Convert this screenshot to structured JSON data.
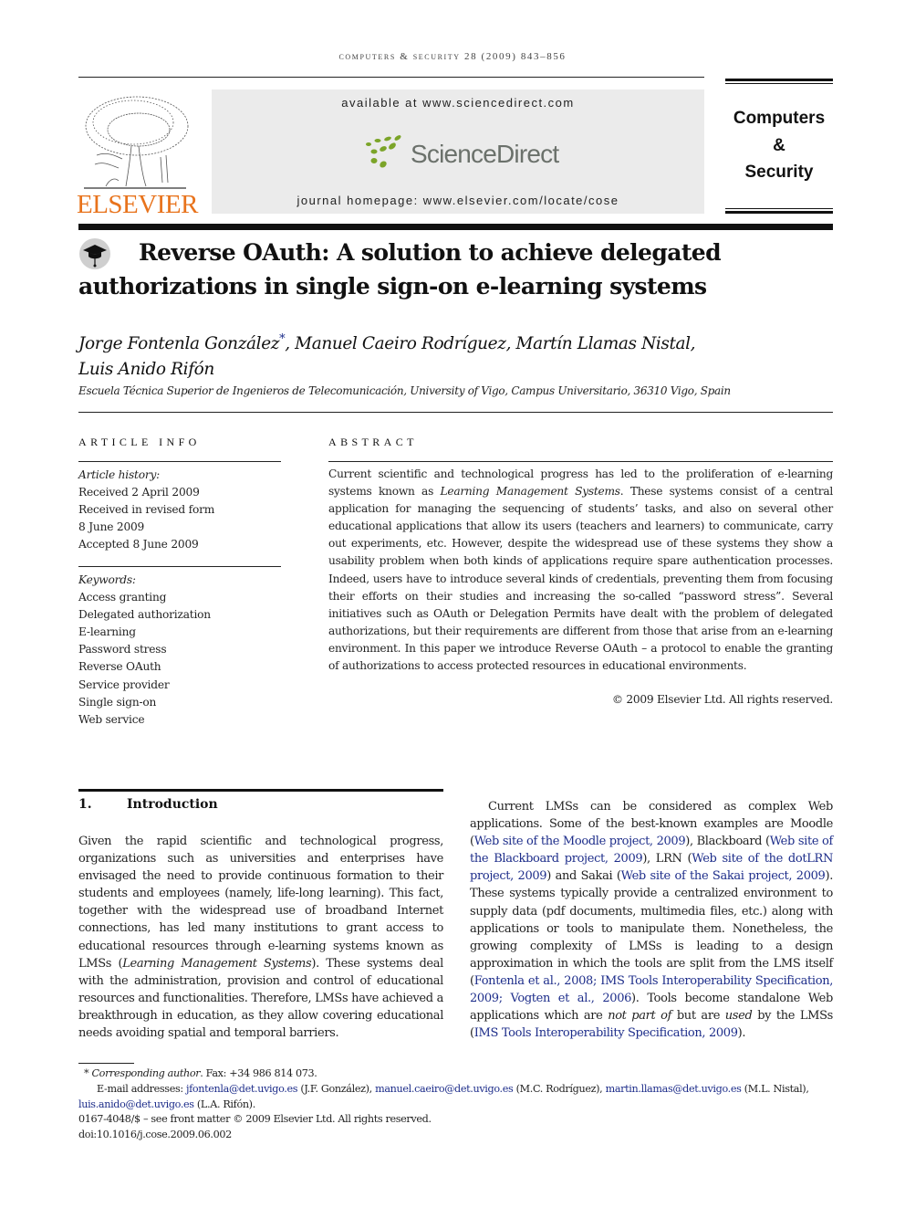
{
  "running_header": "computers & security 28 (2009) 843–856",
  "masthead": {
    "publisher_logo_text": "ELSEVIER",
    "available_text": "available at www.sciencedirect.com",
    "sciencedirect_logo_text": "ScienceDirect",
    "homepage_text": "journal homepage: www.elsevier.com/locate/cose",
    "journal_name_lines": [
      "Computers",
      "&",
      "Security"
    ],
    "colors": {
      "elsevier_orange": "#e8731c",
      "sciencedirect_green": "#7ba428",
      "masthead_bg": "#ebebeb"
    }
  },
  "article": {
    "title": "Reverse OAuth: A solution to achieve delegated authorizations in single sign-on e-learning systems",
    "title_icon": "mortarboard-icon",
    "authors": [
      {
        "name": "Jorge Fontenla González",
        "corresponding_mark": "*"
      },
      {
        "name": "Manuel Caeiro Rodríguez"
      },
      {
        "name": "Martín Llamas Nistal"
      },
      {
        "name": "Luis Anido Rifón"
      }
    ],
    "affiliation": "Escuela Técnica Superior de Ingenieros de Telecomunicación, University of Vigo, Campus Universitario, 36310 Vigo, Spain"
  },
  "article_info": {
    "heading": "ARTICLE INFO",
    "history_label": "Article history:",
    "history": [
      "Received 2 April 2009",
      "Received in revised form",
      "8 June 2009",
      "Accepted 8 June 2009"
    ],
    "keywords_label": "Keywords:",
    "keywords": [
      "Access granting",
      "Delegated authorization",
      "E-learning",
      "Password stress",
      "Reverse OAuth",
      "Service provider",
      "Single sign-on",
      "Web service"
    ]
  },
  "abstract": {
    "heading": "ABSTRACT",
    "text_before_italic": "Current scientific and technological progress has led to the proliferation of e-learning systems known as ",
    "italic": "Learning Management Systems",
    "text_after_italic": ". These systems consist of a central application for managing the sequencing of students’ tasks, and also on several other educational applications that allow its users (teachers and learners) to communicate, carry out experiments, etc. However, despite the widespread use of these systems they show a usability problem when both kinds of applications require spare authentication processes. Indeed, users have to introduce several kinds of credentials, preventing them from focusing their efforts on their studies and increasing the so-called “password stress”. Several initiatives such as OAuth or Delegation Permits have dealt with the problem of delegated authorizations, but their requirements are different from those that arise from an e-learning environment. In this paper we introduce Reverse OAuth – a protocol to enable the granting of authorizations to access protected resources in educational environments.",
    "copyright": "© 2009 Elsevier Ltd. All rights reserved."
  },
  "section1": {
    "number": "1.",
    "title": "Introduction",
    "left": {
      "p1": "Given the rapid scientific and technological progress, organizations such as universities and enterprises have envisaged the need to provide continuous formation to their students and employees (namely, life-long learning). This fact, together with the widespread use of broadband Internet connections, has led many institutions to grant access to educational resources through e-learning systems known as LMSs (",
      "italic": "Learning Management Systems",
      "p2": "). These systems deal with the administration, provision and control of educational resources and functionalities. Therefore, LMSs have achieved a breakthrough in education, as they allow covering educational needs avoiding spatial and temporal barriers."
    },
    "right": {
      "t1": "Current LMSs can be considered as complex Web applications. Some of the best-known examples are Moodle (",
      "ref_moodle": "Web site of the Moodle project, 2009",
      "t2": "), Blackboard (",
      "ref_blackboard": "Web site of the Blackboard project, 2009",
      "t3": "), LRN (",
      "ref_dotlrn": "Web site of the dotLRN project, 2009",
      "t4": ") and Sakai (",
      "ref_sakai": "Web site of the Sakai project, 2009",
      "t5": "). These systems typically provide a centralized environment to supply data (pdf documents, multimedia files, etc.) along with applications or tools to manipulate them. Nonetheless, the growing complexity of LMSs is leading to a design approximation in which the tools are split from the LMS itself (",
      "ref_fontenla": "Fontenla et al., 2008",
      "sep1": "; ",
      "ref_ims1": "IMS Tools Interoperability Specification, 2009",
      "sep2": "; ",
      "ref_vogten": "Vogten et al., 2006",
      "t6": "). Tools become standalone Web applications which are ",
      "italic1": "not part of",
      "t7": " but are ",
      "italic2": "used",
      "t8": " by the LMSs (",
      "ref_ims2": "IMS Tools Interoperability Specification, 2009",
      "t9": ")."
    }
  },
  "footnotes": {
    "corresponding_mark": "*",
    "corresponding_label": "Corresponding author",
    "corresponding_rest": ". Fax: +34 986 814 073.",
    "emails_label": "E-mail addresses: ",
    "emails": [
      {
        "address": "jfontenla@det.uvigo.es",
        "owner": " (J.F. González), "
      },
      {
        "address": "manuel.caeiro@det.uvigo.es",
        "owner": " (M.C. Rodríguez), "
      },
      {
        "address": "martin.llamas@det.uvigo.es",
        "owner": " (M.L. Nistal), "
      },
      {
        "address": "luis.anido@det.uvigo.es",
        "owner": " (L.A. Rifón)."
      }
    ],
    "issn": "0167-4048/$ – see front matter © 2009 Elsevier Ltd. All rights reserved.",
    "doi": "doi:10.1016/j.cose.2009.06.002"
  }
}
